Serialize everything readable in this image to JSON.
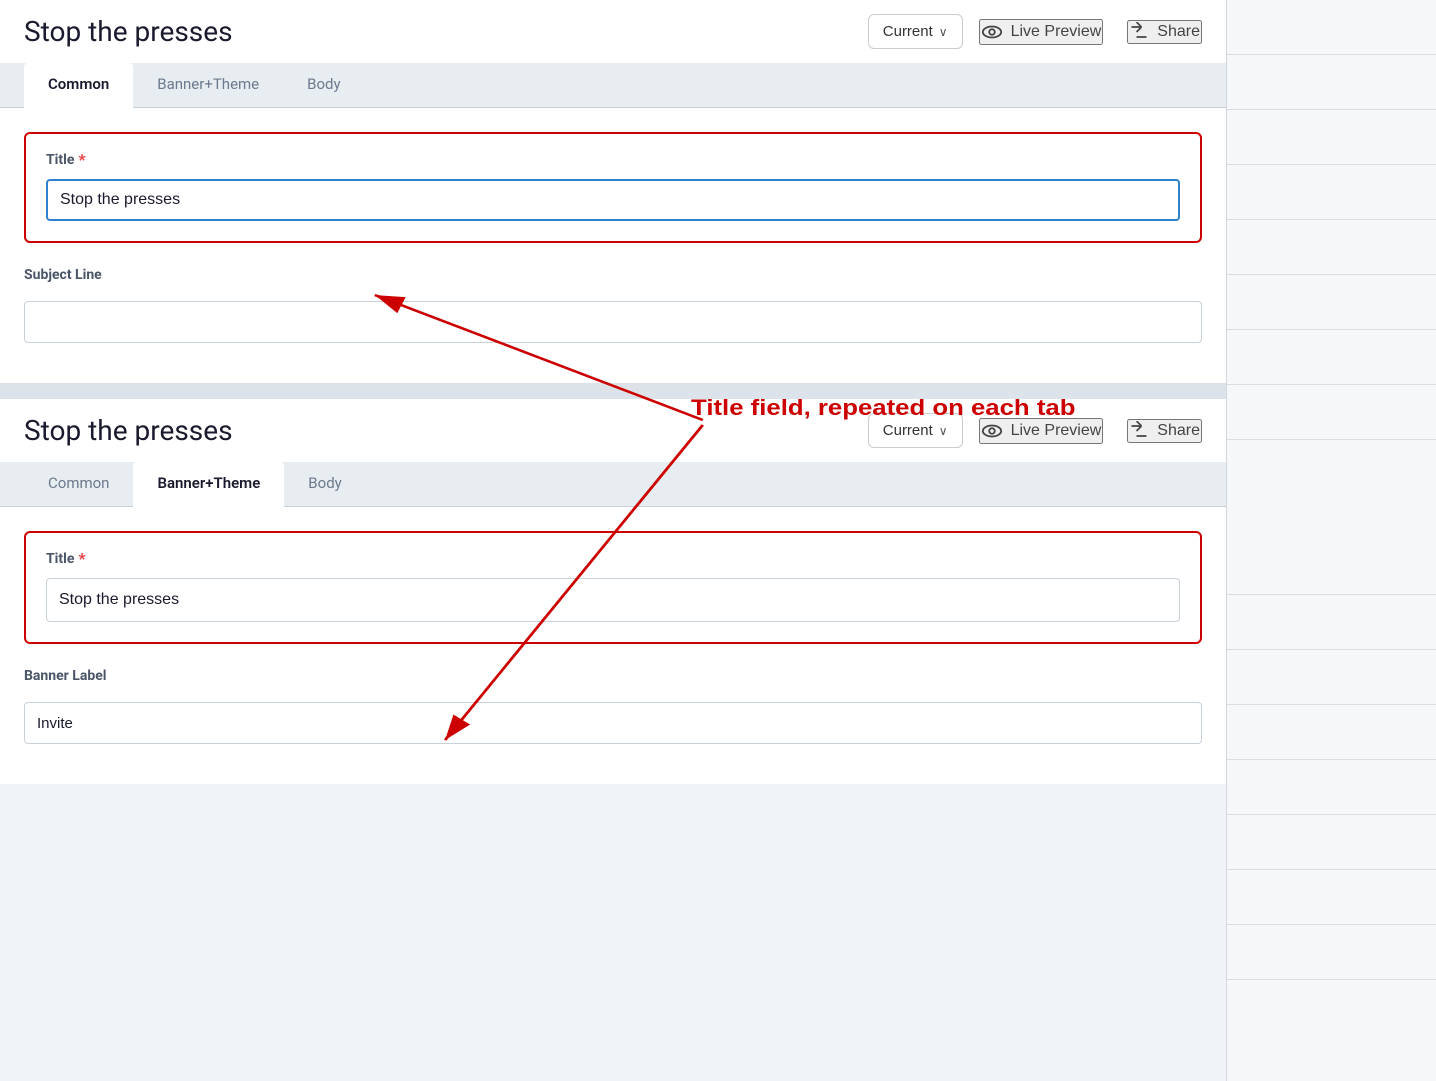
{
  "top": {
    "title": "Stop the presses",
    "version_label": "Current",
    "version_chevron": "∨",
    "live_preview_label": "Live Preview",
    "share_label": "Share",
    "tabs": [
      {
        "id": "common",
        "label": "Common",
        "active": true
      },
      {
        "id": "banner_theme",
        "label": "Banner+Theme",
        "active": false
      },
      {
        "id": "body",
        "label": "Body",
        "active": false
      }
    ],
    "form": {
      "title_label": "Title",
      "title_required": "*",
      "title_value": "Stop the presses",
      "subject_line_label": "Subject Line",
      "subject_line_value": ""
    }
  },
  "bottom": {
    "title": "Stop the presses",
    "version_label": "Current",
    "version_chevron": "∨",
    "live_preview_label": "Live Preview",
    "share_label": "Share",
    "tabs": [
      {
        "id": "common",
        "label": "Common",
        "active": false
      },
      {
        "id": "banner_theme",
        "label": "Banner+Theme",
        "active": true
      },
      {
        "id": "body",
        "label": "Body",
        "active": false
      }
    ],
    "form": {
      "title_label": "Title",
      "title_required": "*",
      "title_value": "Stop the presses",
      "banner_label": "Banner Label",
      "banner_value": "Invite"
    }
  },
  "annotation": {
    "text": "Title field, repeated on each tab"
  },
  "right_panel": {
    "rows": [
      "",
      "",
      "",
      "",
      "",
      "",
      "",
      "",
      "",
      "",
      "",
      "",
      "",
      "",
      "",
      "",
      "",
      "",
      ""
    ]
  }
}
